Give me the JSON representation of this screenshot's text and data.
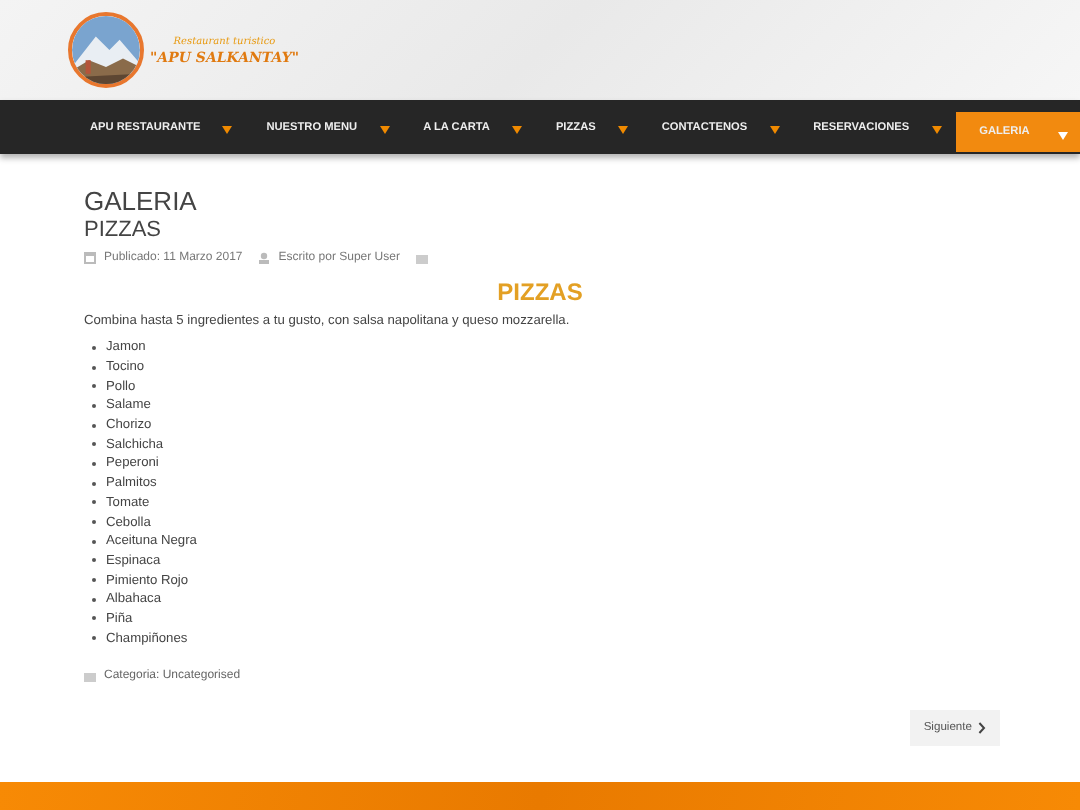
{
  "logo": {
    "tagline": "Restaurant turistico",
    "name": "\"APU SALKANTAY\""
  },
  "nav": [
    {
      "label": "APU RESTAURANTE",
      "selected": false
    },
    {
      "label": "NUESTRO MENU",
      "selected": false
    },
    {
      "label": "A LA CARTA",
      "selected": false
    },
    {
      "label": "PIZZAS",
      "selected": false
    },
    {
      "label": "CONTACTENOS",
      "selected": false
    },
    {
      "label": "RESERVACIONES",
      "selected": false
    },
    {
      "label": "GALERIA",
      "selected": true
    }
  ],
  "page_title": "GALERIA",
  "article_title": "PIZZAS",
  "meta": {
    "published": "Publicado: 11 Marzo 2017",
    "author": "Escrito por Super User"
  },
  "heading": "PIZZAS",
  "intro": "Combina hasta 5 ingredientes a tu gusto, con salsa napolitana y queso mozzarella.",
  "ingredients": [
    "Jamon",
    "Tocino",
    "Pollo",
    "Salame",
    "Chorizo",
    "Salchicha",
    "Peperoni",
    "Palmitos",
    "Tomate",
    "Cebolla",
    "Aceituna Negra",
    "Espinaca",
    "Pimiento Rojo",
    "Albahaca",
    "Piña",
    "Champiñones"
  ],
  "category": "Categoria: Uncategorised",
  "next_button": "Siguiente"
}
